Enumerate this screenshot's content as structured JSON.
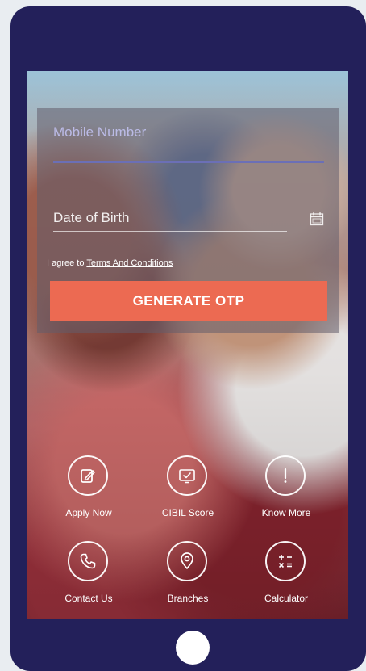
{
  "form": {
    "mobile_placeholder": "Mobile Number",
    "dob_placeholder": "Date of Birth",
    "agree_prefix": "I agree to",
    "terms_link": "Terms And Conditions",
    "otp_button": "GENERATE OTP"
  },
  "menu": [
    {
      "label": "Apply Now",
      "icon": "apply-edit-icon"
    },
    {
      "label": "CIBIL Score",
      "icon": "cibil-score-icon"
    },
    {
      "label": "Know More",
      "icon": "info-exclamation-icon"
    },
    {
      "label": "Contact Us",
      "icon": "phone-icon"
    },
    {
      "label": "Branches",
      "icon": "location-pin-icon"
    },
    {
      "label": "Calculator",
      "icon": "calculator-icon"
    }
  ],
  "colors": {
    "device_frame": "#23205a",
    "primary_button": "#ec6a52",
    "input_underline": "#6b6fb6"
  }
}
